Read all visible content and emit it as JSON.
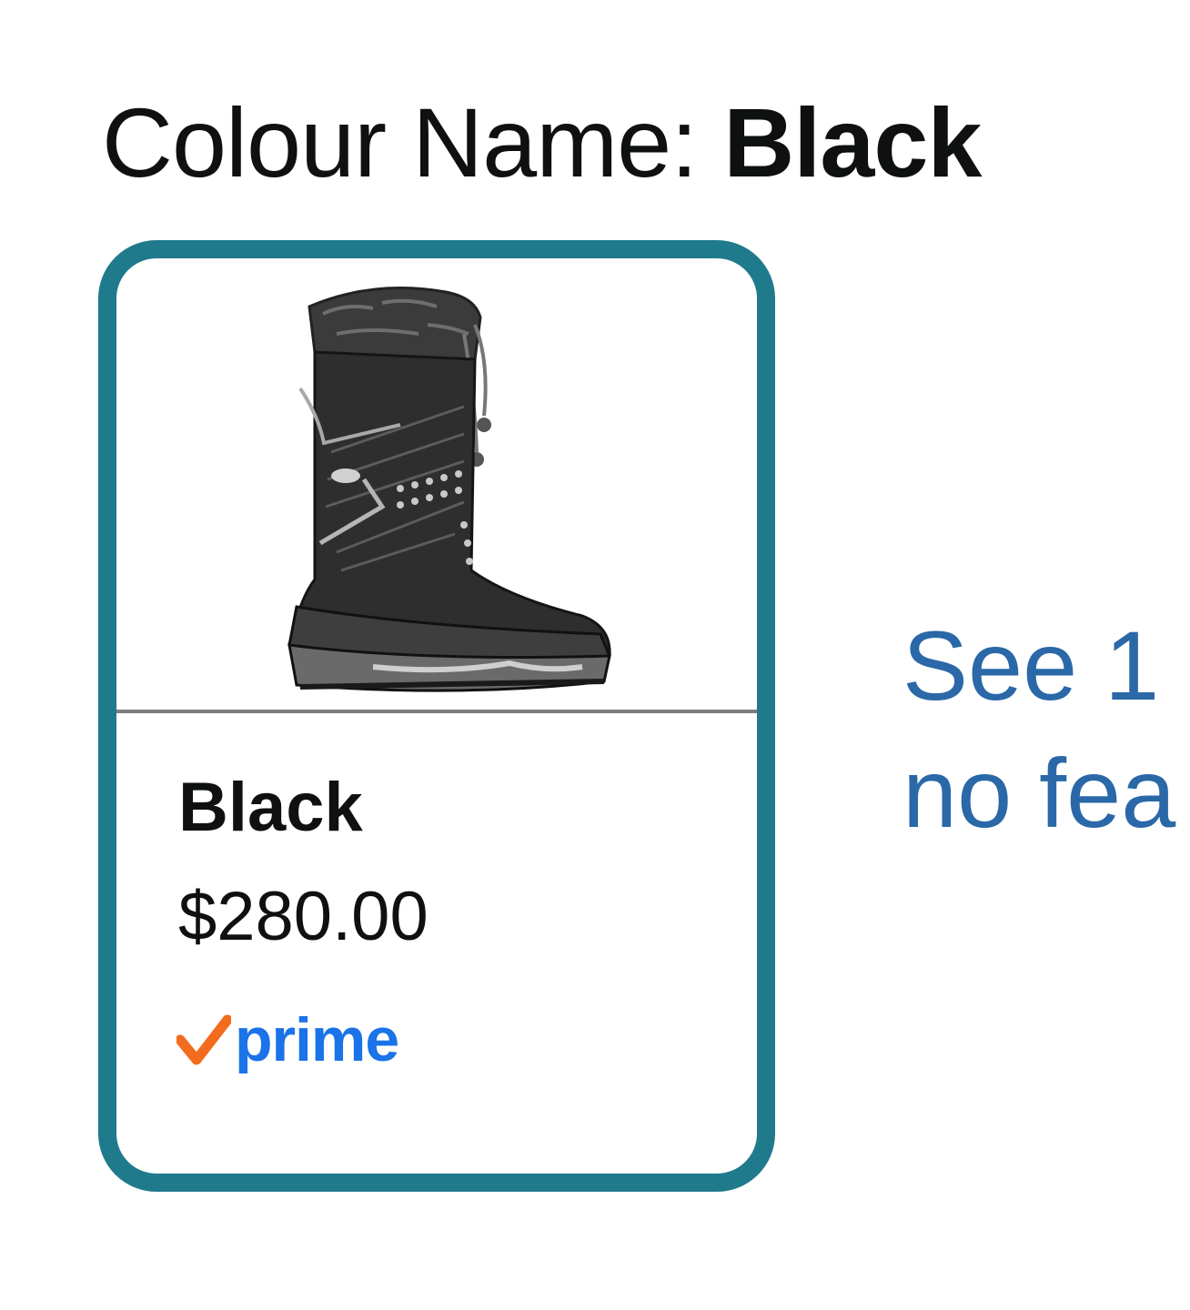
{
  "colour_selector": {
    "label": "Colour Name:",
    "selected_value": "Black"
  },
  "swatch": {
    "image_icon": "winter-boot-image",
    "name": "Black",
    "price": "$280.00",
    "prime_label": "prime",
    "prime_check_icon": "checkmark-icon"
  },
  "see_more_link": {
    "line1": "See 1",
    "line2": "no fea"
  },
  "colors": {
    "selected_border": "#1f7a8c",
    "link": "#2a68a8",
    "prime_blue": "#1a73e8",
    "prime_check": "#f36b1c"
  }
}
